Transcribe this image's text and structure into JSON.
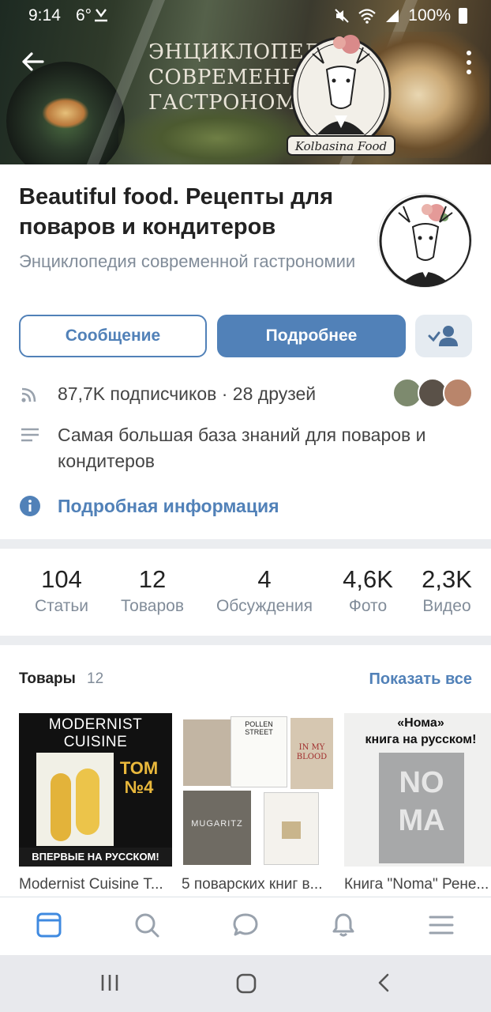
{
  "status_bar": {
    "time": "9:14",
    "temperature": "6°",
    "battery": "100%"
  },
  "cover": {
    "title_lines": [
      "Энциклопедия",
      "современной",
      "гастрономии"
    ],
    "logo_text": "Kolbasina Food"
  },
  "group": {
    "name": "Beautiful food. Рецепты для поваров и кондитеров",
    "status": "Энциклопедия современной гастрономии"
  },
  "actions": {
    "message_label": "Сообщение",
    "details_label": "Подробнее",
    "subscribed_icon": "user-check-icon"
  },
  "info": {
    "subscribers": "87,7K подписчиков · 28 друзей",
    "description": "Самая большая база знаний для поваров и кондитеров",
    "more_info_link": "Подробная информация"
  },
  "counters": [
    {
      "value": "104",
      "label": "Статьи"
    },
    {
      "value": "12",
      "label": "Товаров"
    },
    {
      "value": "4",
      "label": "Обсуждения"
    },
    {
      "value": "4,6K",
      "label": "Фото"
    },
    {
      "value": "2,3K",
      "label": "Видео"
    }
  ],
  "goods": {
    "title": "Товары",
    "count": "12",
    "show_all": "Показать все",
    "items": [
      {
        "caption": "Modernist Cuisine Т...",
        "cover_lines": [
          "MODERNIST",
          "CUISINE"
        ],
        "badge": "ТОМ №4",
        "banner": "ВПЕРВЫЕ НА РУССКОМ!"
      },
      {
        "caption": "5 поварских книг в...",
        "book_titles": [
          "POLLEN STREET",
          "IN MY BLOOD",
          "MUGARITZ"
        ]
      },
      {
        "caption": "Книга \"Noma\" Рене...",
        "cover_lines": [
          "«Нома»",
          "книга на русском!"
        ],
        "book_word": "NOMA"
      }
    ]
  },
  "colors": {
    "accent": "#5181b8",
    "secondary_text": "#818c99",
    "separator": "#ebedf0"
  }
}
